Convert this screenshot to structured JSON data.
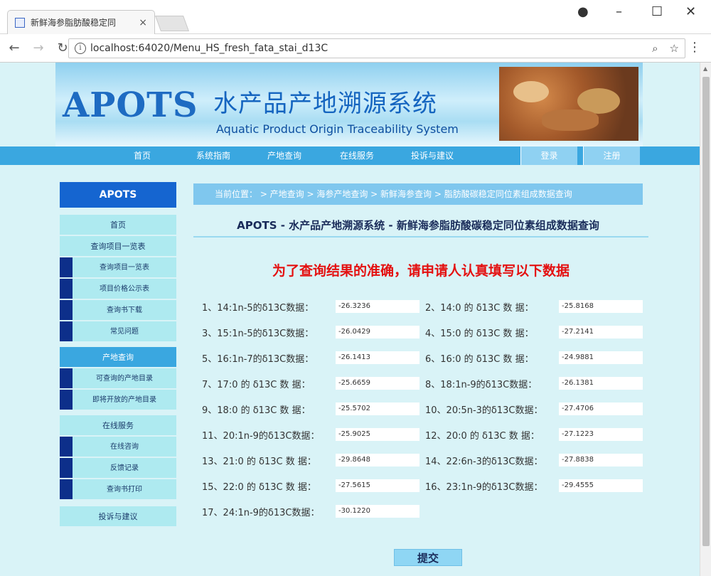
{
  "browser": {
    "tab_title": "新鲜海参脂肪酸稳定同",
    "url": "localhost:64020/Menu_HS_fresh_fata_stai_d13C"
  },
  "banner": {
    "logo": "APOTS",
    "title_cn": "水产品产地溯源系统",
    "title_en": "Aquatic Product Origin Traceability System"
  },
  "nav": {
    "items": [
      "首页",
      "系统指南",
      "产地查询",
      "在线服务",
      "投诉与建议"
    ],
    "login": "登录",
    "register": "注册"
  },
  "sidebar": {
    "head": "APOTS",
    "home": "首页",
    "section1": "查询项目一览表",
    "section1_items": [
      "查询项目一览表",
      "项目价格公示表",
      "查询书下载",
      "常见问题"
    ],
    "section2": "产地查询",
    "section2_items": [
      "可查询的产地目录",
      "即将开放的产地目录"
    ],
    "section3": "在线服务",
    "section3_items": [
      "在线咨询",
      "反馈记录",
      "查询书打印"
    ],
    "section4": "投诉与建议"
  },
  "breadcrumb": "当前位置：  > 产地查询 > 海参产地查询 > 新鲜海参查询 > 脂肪酸碳稳定同位素组成数据查询",
  "form": {
    "title": "APOTS - 水产品产地溯源系统 - 新鲜海参脂肪酸碳稳定同位素组成数据查询",
    "notice": "为了查询结果的准确，请申请人认真填写以下数据",
    "fields": [
      {
        "label": "1、14:1n-5的δ13C数据：",
        "value": "-26.3236"
      },
      {
        "label": "2、14:0 的 δ13C 数 据：",
        "value": "-25.8168"
      },
      {
        "label": "3、15:1n-5的δ13C数据：",
        "value": "-26.0429"
      },
      {
        "label": "4、15:0 的 δ13C 数 据：",
        "value": "-27.2141"
      },
      {
        "label": "5、16:1n-7的δ13C数据：",
        "value": "-26.1413"
      },
      {
        "label": "6、16:0 的 δ13C 数 据：",
        "value": "-24.9881"
      },
      {
        "label": "7、17:0 的 δ13C 数 据：",
        "value": "-25.6659"
      },
      {
        "label": "8、18:1n-9的δ13C数据：",
        "value": "-26.1381"
      },
      {
        "label": "9、18:0 的 δ13C 数 据：",
        "value": "-25.5702"
      },
      {
        "label": "10、20:5n-3的δ13C数据：",
        "value": "-27.4706"
      },
      {
        "label": "11、20:1n-9的δ13C数据：",
        "value": "-25.9025"
      },
      {
        "label": "12、20:0 的 δ13C 数 据：",
        "value": "-27.1223"
      },
      {
        "label": "13、21:0 的 δ13C 数 据：",
        "value": "-29.8648"
      },
      {
        "label": "14、22:6n-3的δ13C数据：",
        "value": "-27.8838"
      },
      {
        "label": "15、22:0 的 δ13C 数 据：",
        "value": "-27.5615"
      },
      {
        "label": "16、23:1n-9的δ13C数据：",
        "value": "-29.4555"
      },
      {
        "label": "17、24:1n-9的δ13C数据：",
        "value": "-30.1220"
      }
    ],
    "submit": "提交"
  }
}
